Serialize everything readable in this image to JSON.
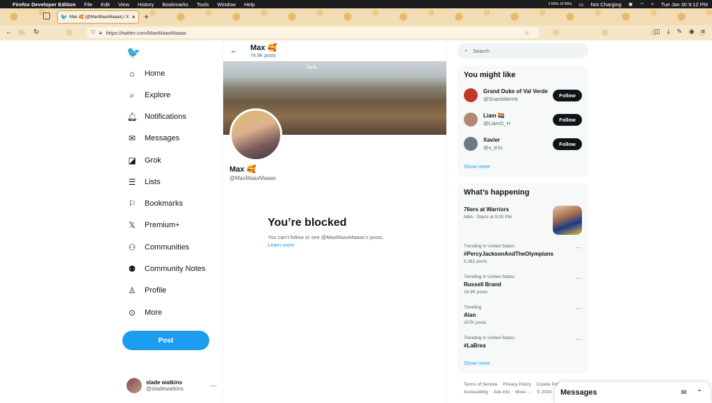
{
  "macbar": {
    "app": "Firefox Developer Edition",
    "menus": [
      "File",
      "Edit",
      "View",
      "History",
      "Bookmarks",
      "Tools",
      "Window",
      "Help"
    ],
    "battery": "Not Charging",
    "clock": "Tue Jan 30  9:12 PM",
    "network": "2 KB/s 10 KB/s"
  },
  "browser": {
    "tab_title": "Max 🥰 (@MaxMaaxMaaax) / X",
    "url": "https://twitter.com/MaxMaaxMaaax"
  },
  "nav": {
    "items": [
      {
        "label": "Home",
        "icon": "home-icon"
      },
      {
        "label": "Explore",
        "icon": "search-icon"
      },
      {
        "label": "Notifications",
        "icon": "bell-icon"
      },
      {
        "label": "Messages",
        "icon": "mail-icon"
      },
      {
        "label": "Grok",
        "icon": "grok-icon"
      },
      {
        "label": "Lists",
        "icon": "list-icon"
      },
      {
        "label": "Bookmarks",
        "icon": "bookmark-icon"
      },
      {
        "label": "Premium+",
        "icon": "x-logo-icon"
      },
      {
        "label": "Communities",
        "icon": "people-icon"
      },
      {
        "label": "Community Notes",
        "icon": "notes-icon"
      },
      {
        "label": "Profile",
        "icon": "user-icon"
      },
      {
        "label": "More",
        "icon": "more-circle-icon"
      }
    ],
    "post_label": "Post"
  },
  "account": {
    "name": "slade watkins",
    "handle": "@sladewatkins"
  },
  "profile": {
    "header_name": "Max 🥰",
    "post_count": "74.9K posts",
    "banner_text": "fuck.",
    "name": "Max 🥰",
    "handle": "@MaxMaaxMaaax",
    "blocked_title": "You’re blocked",
    "blocked_sub": "You can’t follow or see @MaxMaaxMaaax’s posts.",
    "learn_more": "Learn more"
  },
  "search": {
    "placeholder": "Search"
  },
  "who_to_follow": {
    "title": "You might like",
    "users": [
      {
        "name": "Grand Duke of Val Verde",
        "handle": "@SnackMerritt",
        "button": "Follow",
        "color": "#c0392b"
      },
      {
        "name": "Liam 🏳️‍🌈",
        "handle": "@LiamD_H",
        "button": "Follow",
        "color": "#b08a70"
      },
      {
        "name": "Xavier",
        "handle": "@x_tr1c",
        "button": "Follow",
        "color": "#6a7a8a"
      }
    ],
    "show_more": "Show more"
  },
  "trends": {
    "title": "What’s happening",
    "featured": {
      "title": "76ers at Warriors",
      "sub": "NBA · Starts at 9:00 PM"
    },
    "items": [
      {
        "context": "Trending in United States",
        "title": "#PercyJacksonAndTheOlympians",
        "posts": "5,362 posts"
      },
      {
        "context": "Trending in United States",
        "title": "Russell Brand",
        "posts": "16.9K posts"
      },
      {
        "context": "Trending",
        "title": "Alan",
        "posts": "207K posts"
      },
      {
        "context": "Trending in United States",
        "title": "#LaBrea",
        "posts": ""
      }
    ],
    "show_more": "Show more"
  },
  "footer": {
    "links": [
      "Terms of Service",
      "Privacy Policy",
      "Cookie Policy",
      "Accessibility",
      "Ads info",
      "More ···",
      "© 2024"
    ]
  },
  "messages_drawer": {
    "title": "Messages"
  }
}
